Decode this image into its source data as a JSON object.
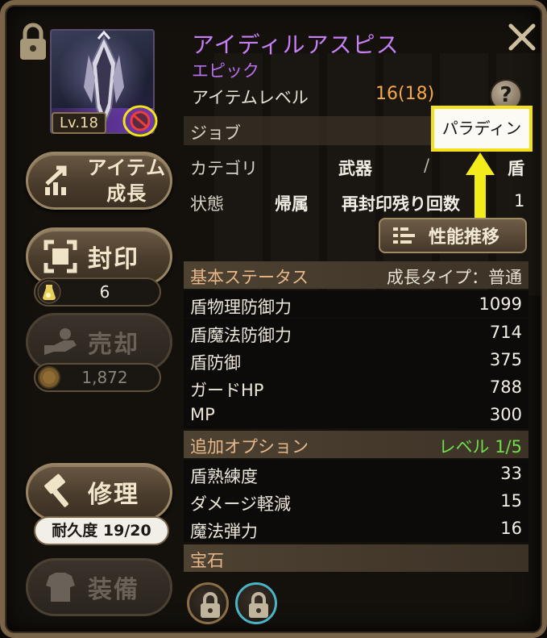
{
  "item": {
    "name": "アイディルアスピス",
    "rarity": "エピック",
    "level_badge": "Lv.18",
    "item_level_label": "アイテムレベル",
    "item_level_value": "16(18)",
    "help_symbol": "?"
  },
  "info": {
    "job_label": "ジョブ",
    "job_value": "パラディン",
    "category_label": "カテゴリ",
    "category_main": "武器",
    "category_sep": "/",
    "category_sub": "盾",
    "status_label": "状態",
    "status_value": "帰属",
    "reseal_label": "再封印残り回数",
    "reseal_value": "1",
    "performance_button": "性能推移"
  },
  "side_buttons": {
    "growth_label": "アイテム\n成長",
    "seal_label": "封印",
    "seal_count": "6",
    "sell_label": "売却",
    "sell_price": "1,872",
    "repair_label": "修理",
    "durability": "耐久度 19/20",
    "equip_label": "装備"
  },
  "base_stats": {
    "header": "基本ステータス",
    "growth_type": "成長タイプ：普通",
    "rows": [
      {
        "name": "盾物理防御力",
        "value": "1099"
      },
      {
        "name": "盾魔法防御力",
        "value": "714"
      },
      {
        "name": "盾防御",
        "value": "375"
      },
      {
        "name": "ガードHP",
        "value": "788"
      },
      {
        "name": "MP",
        "value": "300"
      }
    ]
  },
  "extra_options": {
    "header": "追加オプション",
    "level": "レベル 1/5",
    "rows": [
      {
        "name": "盾熟練度",
        "value": "33"
      },
      {
        "name": "ダメージ軽減",
        "value": "15"
      },
      {
        "name": "魔法弾力",
        "value": "16"
      }
    ]
  },
  "gems": {
    "header": "宝石"
  },
  "colors": {
    "epic_purple": "#c77ff5",
    "highlight_yellow": "#f4e11c",
    "option_green": "#6fe04a",
    "section_text": "#e9b88a"
  }
}
